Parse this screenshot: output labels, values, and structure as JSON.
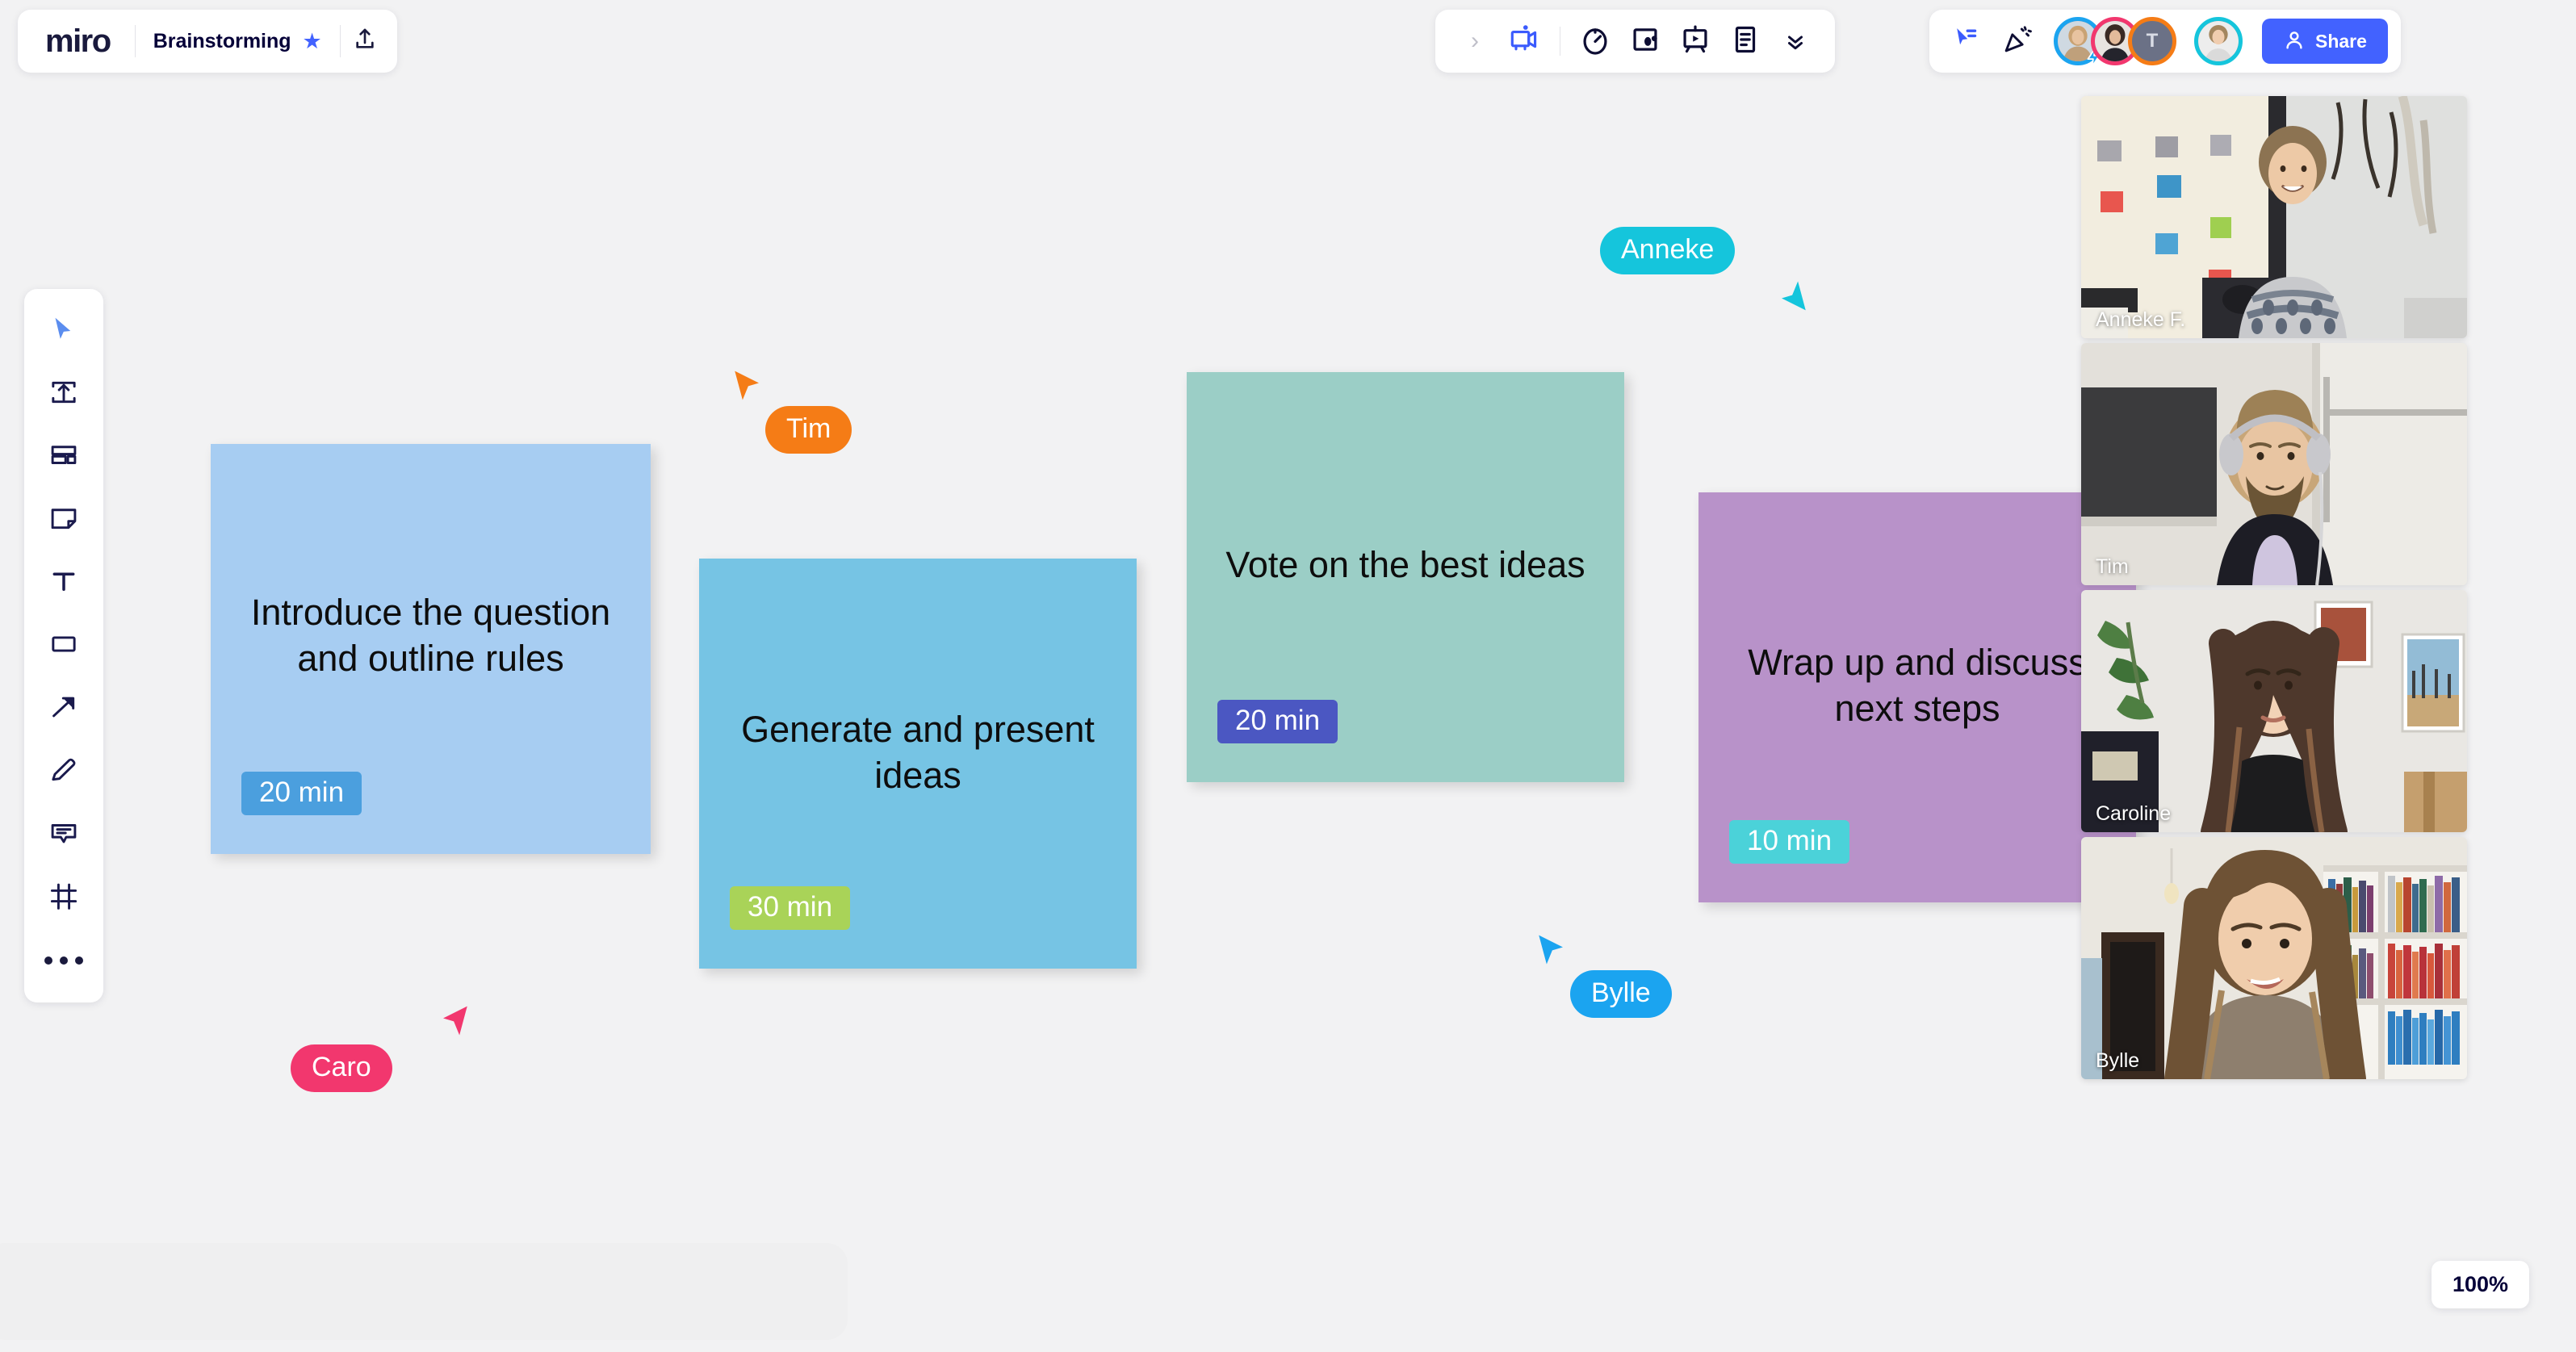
{
  "header": {
    "logo_text": "miro",
    "board_title": "Brainstorming",
    "star_icon": "star-favorite-icon",
    "upload_icon": "upload-share-icon"
  },
  "center_toolbar": {
    "items": [
      {
        "name": "expand-chevron-right",
        "icon": "chevron-right-icon",
        "label": ""
      },
      {
        "name": "video-chat",
        "icon": "video-camera-icon",
        "label": ""
      },
      {
        "name": "timer",
        "icon": "stopwatch-timer-icon",
        "label": ""
      },
      {
        "name": "voting",
        "icon": "voting-icon",
        "label": ""
      },
      {
        "name": "presentation",
        "icon": "presentation-play-icon",
        "label": ""
      },
      {
        "name": "notes",
        "icon": "document-notes-icon",
        "label": ""
      },
      {
        "name": "more-tools",
        "icon": "chevron-double-down-icon",
        "label": ""
      }
    ]
  },
  "right_toolbar": {
    "cursor_chat_icon": "cursor-chat-icon",
    "reactions_icon": "party-popper-icon",
    "collaborators": [
      {
        "name": "Bylle",
        "ring_color": "#1BA4F0",
        "initial": "",
        "badge": "lightning-bolt-icon"
      },
      {
        "name": "Caro",
        "ring_color": "#F2376E",
        "initial": "",
        "badge": ""
      },
      {
        "name": "Tim",
        "ring_color": "#F57C16",
        "initial": "T",
        "badge": ""
      },
      {
        "name": "Anneke",
        "ring_color": "#15C5DC",
        "initial": "",
        "badge": ""
      }
    ],
    "share": {
      "label": "Share",
      "icon": "person-add-icon",
      "color": "#4262FF"
    }
  },
  "left_rail": {
    "tools": [
      {
        "name": "select-cursor",
        "icon": "cursor-arrow-icon",
        "active": true
      },
      {
        "name": "upload-import",
        "icon": "upload-box-icon",
        "active": false
      },
      {
        "name": "templates",
        "icon": "templates-icon",
        "active": false
      },
      {
        "name": "sticky-note",
        "icon": "sticky-note-icon",
        "active": false
      },
      {
        "name": "text",
        "icon": "text-t-icon",
        "active": false
      },
      {
        "name": "shapes",
        "icon": "rectangle-shape-icon",
        "active": false
      },
      {
        "name": "connector",
        "icon": "arrow-line-icon",
        "active": false
      },
      {
        "name": "pen",
        "icon": "pen-pencil-icon",
        "active": false
      },
      {
        "name": "comment",
        "icon": "comment-bubble-icon",
        "active": false
      },
      {
        "name": "frame",
        "icon": "frame-icon",
        "active": false
      },
      {
        "name": "more-tools",
        "icon": "three-dots-icon",
        "active": false
      }
    ]
  },
  "canvas": {
    "notes": [
      {
        "id": "note-1",
        "text": "Introduce the question and outline rules",
        "note_color": "#A7CDF2",
        "badge_label": "20 min",
        "badge_color": "#4B9FDE"
      },
      {
        "id": "note-2",
        "text": "Generate and present ideas",
        "note_color": "#76C4E4",
        "badge_label": "30 min",
        "badge_color": "#A9D358"
      },
      {
        "id": "note-3",
        "text": "Vote on the best ideas",
        "note_color": "#9BCEC6",
        "badge_label": "20 min",
        "badge_color": "#4B57C2"
      },
      {
        "id": "note-4",
        "text": "Wrap up and discuss next steps",
        "note_color": "#B892C9",
        "badge_label": "10 min",
        "badge_color": "#4BD2D9"
      }
    ],
    "cursors": [
      {
        "id": "cur-tim",
        "label": "Tim",
        "color": "#F57C16"
      },
      {
        "id": "cur-caro",
        "label": "Caro",
        "color": "#F2376E"
      },
      {
        "id": "cur-anneke",
        "label": "Anneke",
        "color": "#15C5DC"
      },
      {
        "id": "cur-bylle",
        "label": "Bylle",
        "color": "#1BA4F0"
      }
    ]
  },
  "video_panel": {
    "tiles": [
      {
        "name": "Anneke F."
      },
      {
        "name": "Tim"
      },
      {
        "name": "Caroline"
      },
      {
        "name": "Bylle"
      }
    ]
  },
  "zoom": {
    "level": "100%"
  }
}
